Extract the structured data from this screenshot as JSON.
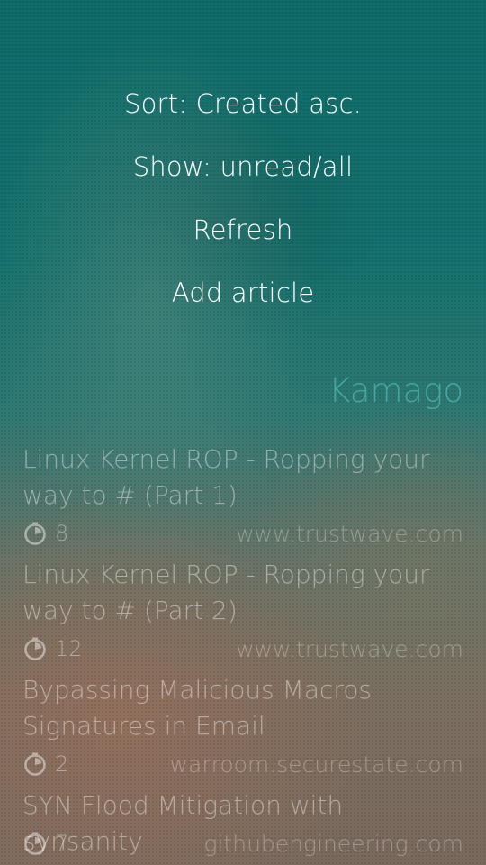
{
  "pulley_menu": {
    "items": [
      {
        "label": "Sort: Created asc."
      },
      {
        "label": "Show: unread/all"
      },
      {
        "label": "Refresh"
      },
      {
        "label": "Add article"
      }
    ]
  },
  "header": {
    "title": "Kamago"
  },
  "articles": [
    {
      "title": "Linux Kernel ROP - Ropping your way to # (Part 1)",
      "reading_time": "8",
      "domain": "www.trustwave.com"
    },
    {
      "title": "Linux Kernel ROP - Ropping your way to # (Part 2)",
      "reading_time": "12",
      "domain": "www.trustwave.com"
    },
    {
      "title": "Bypassing Malicious Macros Signatures in Email",
      "reading_time": "2",
      "domain": "warroom.securestate.com"
    },
    {
      "title": "SYN Flood Mitigation with synsanity",
      "reading_time": "7",
      "domain": "githubengineering.com"
    }
  ],
  "icons": {
    "reading_time": "timer-icon"
  }
}
